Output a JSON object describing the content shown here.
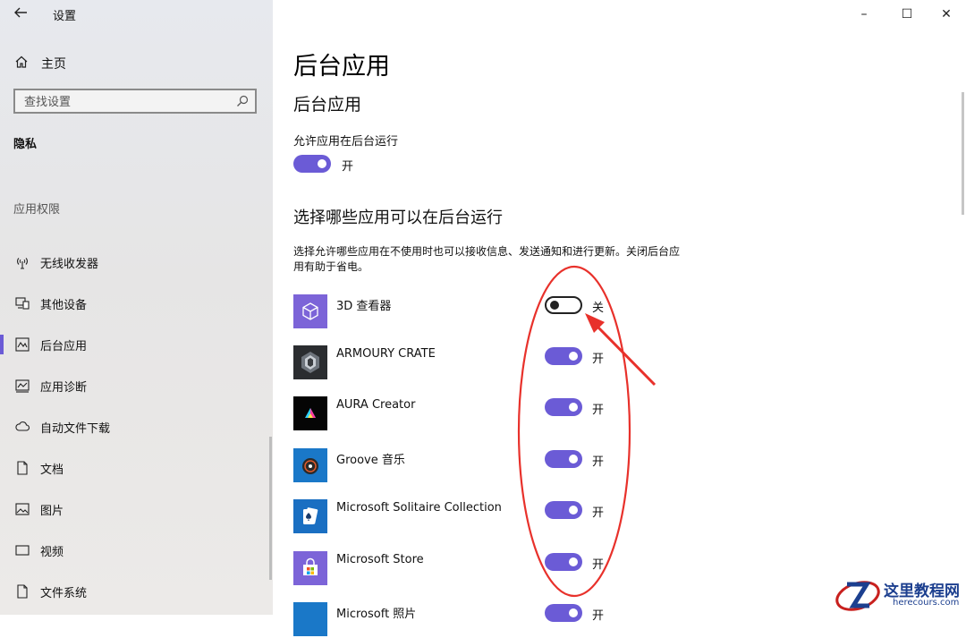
{
  "window": {
    "title": "设置",
    "controls": {
      "minimize": "–",
      "maximize": "☐",
      "close": "✕"
    }
  },
  "sidebar": {
    "home_label": "主页",
    "search_placeholder": "查找设置",
    "section_label": "隐私",
    "permissions_label": "应用权限",
    "items": [
      {
        "label": "无线收发器",
        "icon": "radio-tower-icon"
      },
      {
        "label": "其他设备",
        "icon": "devices-icon"
      },
      {
        "label": "后台应用",
        "icon": "background-apps-icon",
        "active": true
      },
      {
        "label": "应用诊断",
        "icon": "diagnostics-icon"
      },
      {
        "label": "自动文件下载",
        "icon": "cloud-icon"
      },
      {
        "label": "文档",
        "icon": "document-icon"
      },
      {
        "label": "图片",
        "icon": "picture-icon"
      },
      {
        "label": "视频",
        "icon": "video-icon"
      },
      {
        "label": "文件系统",
        "icon": "file-system-icon"
      }
    ]
  },
  "main": {
    "page_title": "后台应用",
    "subtitle": "后台应用",
    "allow_label": "允许应用在后台运行",
    "allow_state": "开",
    "choose_title": "选择哪些应用可以在后台运行",
    "description": "选择允许哪些应用在不使用时也可以接收信息、发送通知和进行更新。关闭后台应用有助于省电。",
    "apps": [
      {
        "name": "3D 查看器",
        "state": "关",
        "on": false,
        "icon": "3d-viewer-icon"
      },
      {
        "name": "ARMOURY CRATE",
        "state": "开",
        "on": true,
        "icon": "armoury-crate-icon"
      },
      {
        "name": "AURA Creator",
        "state": "开",
        "on": true,
        "icon": "aura-creator-icon"
      },
      {
        "name": "Groove 音乐",
        "state": "开",
        "on": true,
        "icon": "groove-music-icon"
      },
      {
        "name": "Microsoft Solitaire Collection",
        "state": "开",
        "on": true,
        "icon": "solitaire-icon"
      },
      {
        "name": "Microsoft Store",
        "state": "开",
        "on": true,
        "icon": "store-icon"
      },
      {
        "name": "Microsoft 照片",
        "state": "开",
        "on": true,
        "icon": "photos-icon"
      }
    ]
  },
  "colors": {
    "accent": "#6b5bd6",
    "annotation": "#e8312b"
  },
  "watermark": {
    "title": "这里教程网",
    "subtitle": "herecours.com"
  }
}
